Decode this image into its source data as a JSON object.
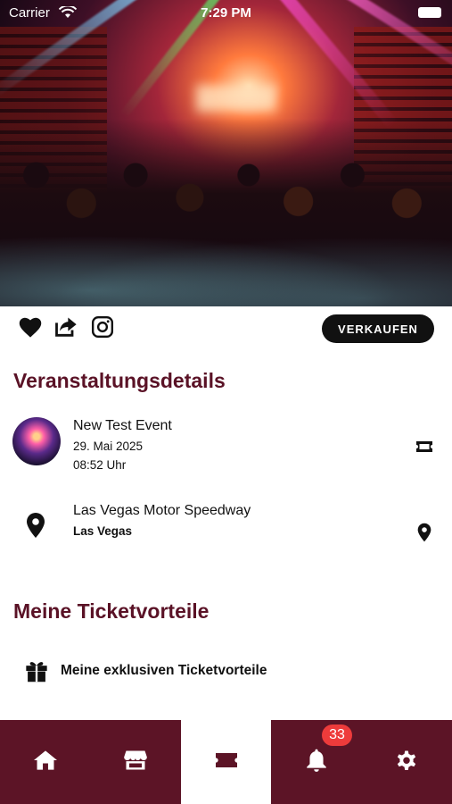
{
  "status_bar": {
    "carrier": "Carrier",
    "time": "7:29 PM"
  },
  "actions": {
    "sell_label": "VERKAUFEN"
  },
  "event_section": {
    "title": "Veranstaltungsdetails",
    "event_name": "New Test Event",
    "date": "29. Mai 2025",
    "time": "08:52 Uhr",
    "venue": "Las Vegas Motor Speedway",
    "city": "Las Vegas"
  },
  "perks_section": {
    "title": "Meine Ticketvorteile",
    "item_label": "Meine exklusiven Ticketvorteile"
  },
  "bottom_nav": {
    "items": [
      {
        "icon": "home-icon",
        "active": false
      },
      {
        "icon": "shop-icon",
        "active": false
      },
      {
        "icon": "ticket-icon",
        "active": true
      },
      {
        "icon": "bell-icon",
        "active": false
      },
      {
        "icon": "gear-icon",
        "active": false
      }
    ],
    "notification_count": "33"
  },
  "colors": {
    "brand": "#5c1426",
    "badge": "#ee3b3b",
    "title": "#5a1226"
  }
}
